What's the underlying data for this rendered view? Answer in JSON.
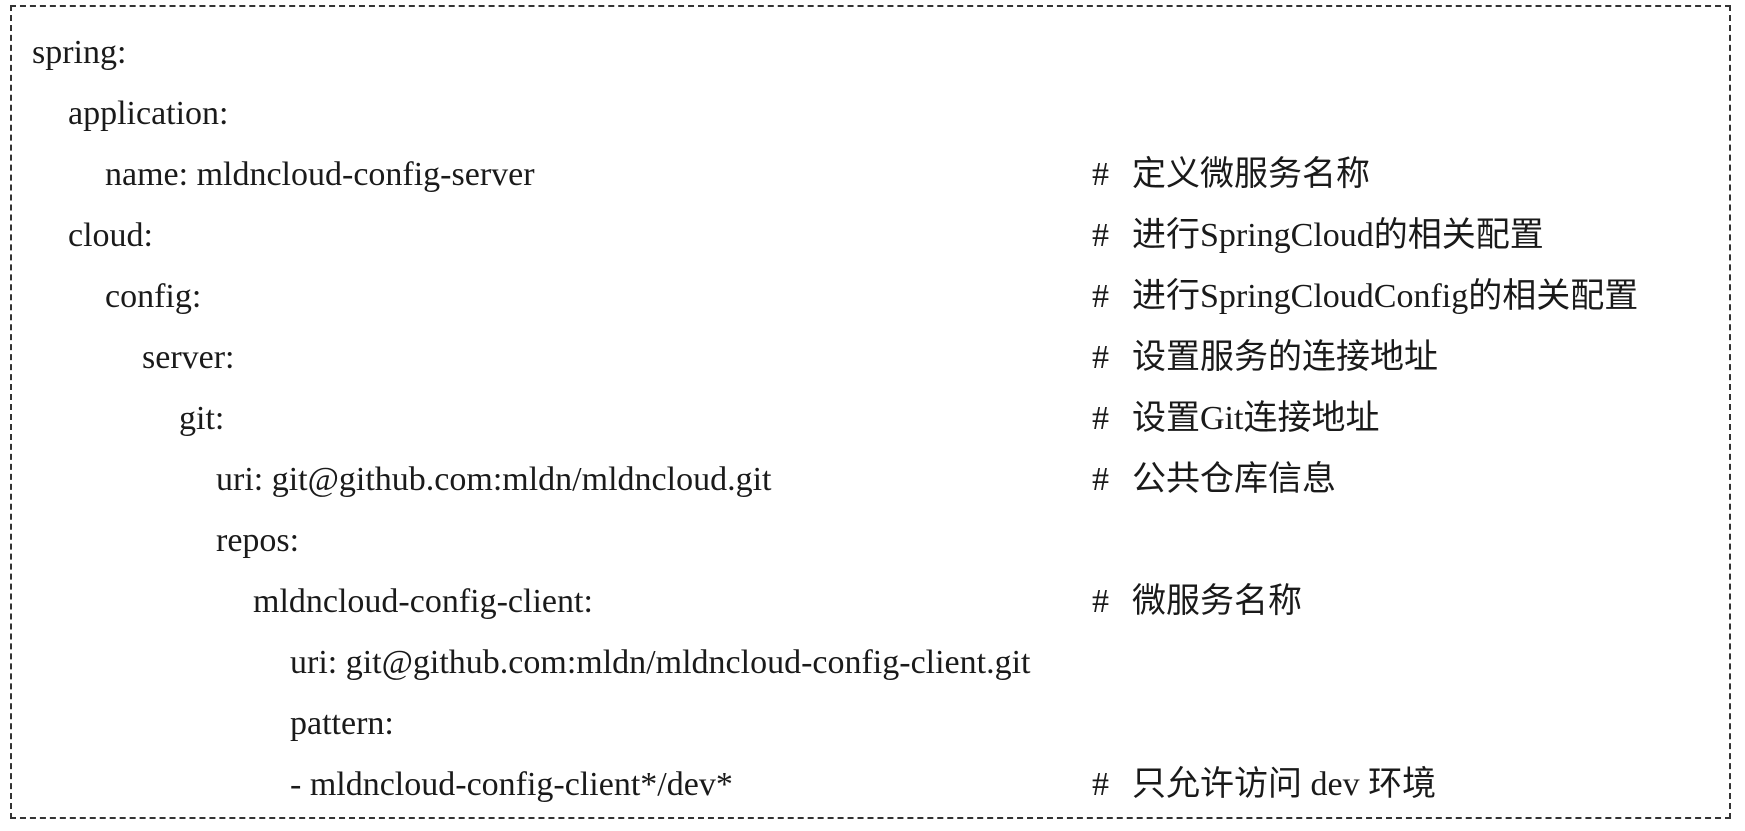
{
  "document": {
    "lines": [
      {
        "code": "spring:",
        "comment": ""
      },
      {
        "code": "application:",
        "comment": ""
      },
      {
        "code": "name: mldncloud-config-server",
        "comment": "定义微服务名称"
      },
      {
        "code": "cloud:",
        "comment": "进行SpringCloud的相关配置"
      },
      {
        "code": "config:",
        "comment": "进行SpringCloudConfig的相关配置"
      },
      {
        "code": "server:",
        "comment": "设置服务的连接地址"
      },
      {
        "code": "git:",
        "comment": "设置Git连接地址"
      },
      {
        "code": "uri: git@github.com:mldn/mldncloud.git",
        "comment": "公共仓库信息"
      },
      {
        "code": "repos:",
        "comment": ""
      },
      {
        "code": "mldncloud-config-client:",
        "comment": "微服务名称"
      },
      {
        "code": "uri: git@github.com:mldn/mldncloud-config-client.git",
        "comment": ""
      },
      {
        "code": "pattern:",
        "comment": ""
      },
      {
        "code": "- mldncloud-config-client*/dev*",
        "comment": "只允许访问 dev 环境"
      }
    ],
    "comment_marker": "#"
  }
}
